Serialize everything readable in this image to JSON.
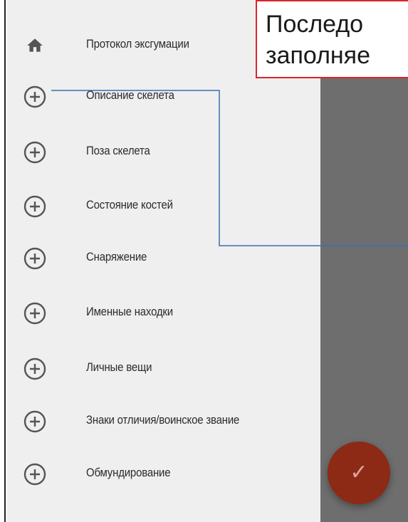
{
  "menu": {
    "items": [
      {
        "icon": "home-icon",
        "label": "Протокол эксгумации"
      },
      {
        "icon": "add-circle-icon",
        "label": "Описание скелета"
      },
      {
        "icon": "add-circle-icon",
        "label": "Поза скелета"
      },
      {
        "icon": "add-circle-icon",
        "label": "Состояние костей"
      },
      {
        "icon": "add-circle-icon",
        "label": "Снаряжение"
      },
      {
        "icon": "add-circle-icon",
        "label": "Именные находки"
      },
      {
        "icon": "add-circle-icon",
        "label": "Личные вещи"
      },
      {
        "icon": "add-circle-icon",
        "label": "Знаки отличия/воинское звание"
      },
      {
        "icon": "add-circle-icon",
        "label": "Обмундирование"
      }
    ]
  },
  "callout": {
    "line1": "Последо",
    "line2": "заполняе"
  },
  "fab": {
    "icon": "check-icon",
    "glyph": "✓"
  },
  "colors": {
    "drawer_bg": "#efefef",
    "scrim": "#6e6e6e",
    "icon": "#555555",
    "callout_border": "#d9262b",
    "connector": "#3a6fb0",
    "fab": "#8c2a15"
  }
}
